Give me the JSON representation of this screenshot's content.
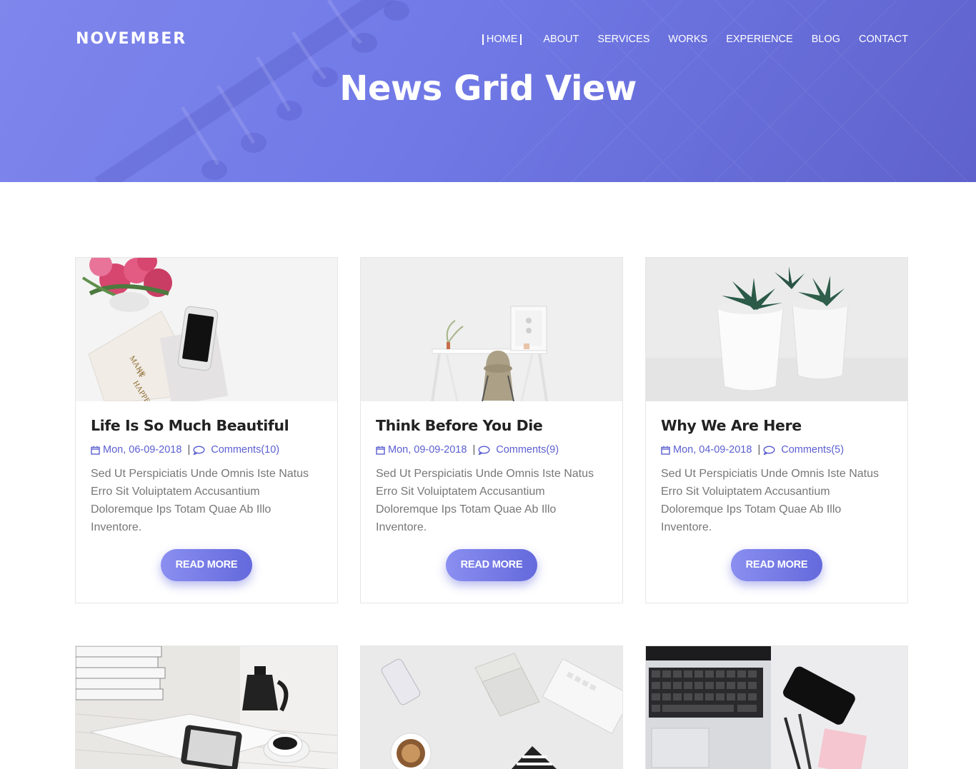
{
  "header": {
    "brand": "NOVEMBER",
    "nav": [
      {
        "label": "HOME"
      },
      {
        "label": "ABOUT"
      },
      {
        "label": "SERVICES"
      },
      {
        "label": "WORKS"
      },
      {
        "label": "EXPERIENCE"
      },
      {
        "label": "BLOG"
      },
      {
        "label": "CONTACT"
      }
    ],
    "page_title": "News Grid View"
  },
  "posts": [
    {
      "title": "Life Is So Much Beautiful",
      "date": "Mon, 06-09-2018",
      "comments": "Comments(10)",
      "excerpt": "Sed Ut Perspiciatis Unde Omnis Iste Natus Erro Sit Voluiptatem Accusantium Doloremque Ips Totam Quae Ab Illo Inventore.",
      "button": "READ MORE",
      "image": "flowers-phone-notebook-photo"
    },
    {
      "title": "Think Before You Die",
      "date": "Mon, 09-09-2018",
      "comments": "Comments(9)",
      "excerpt": "Sed Ut Perspiciatis Unde Omnis Iste Natus Erro Sit Voluiptatem Accusantium Doloremque Ips Totam Quae Ab Illo Inventore.",
      "button": "READ MORE",
      "image": "desk-chair-photo"
    },
    {
      "title": "Why We Are Here",
      "date": "Mon, 04-09-2018",
      "comments": "Comments(5)",
      "excerpt": "Sed Ut Perspiciatis Unde Omnis Iste Natus Erro Sit Voluiptatem Accusantium Doloremque Ips Totam Quae Ab Illo Inventore.",
      "button": "READ MORE",
      "image": "succulent-pots-photo"
    },
    {
      "image": "magazines-coffee-photo"
    },
    {
      "image": "keyboard-coffee-flatlay-photo"
    },
    {
      "image": "laptop-phone-pens-photo"
    }
  ],
  "colors": {
    "accent": "#6469dc",
    "hero_start": "#7f86ec",
    "hero_end": "#5f62cc",
    "meta": "#5b5fd0"
  },
  "icons": {
    "date": "calendar-icon",
    "comments": "comment-icon"
  }
}
